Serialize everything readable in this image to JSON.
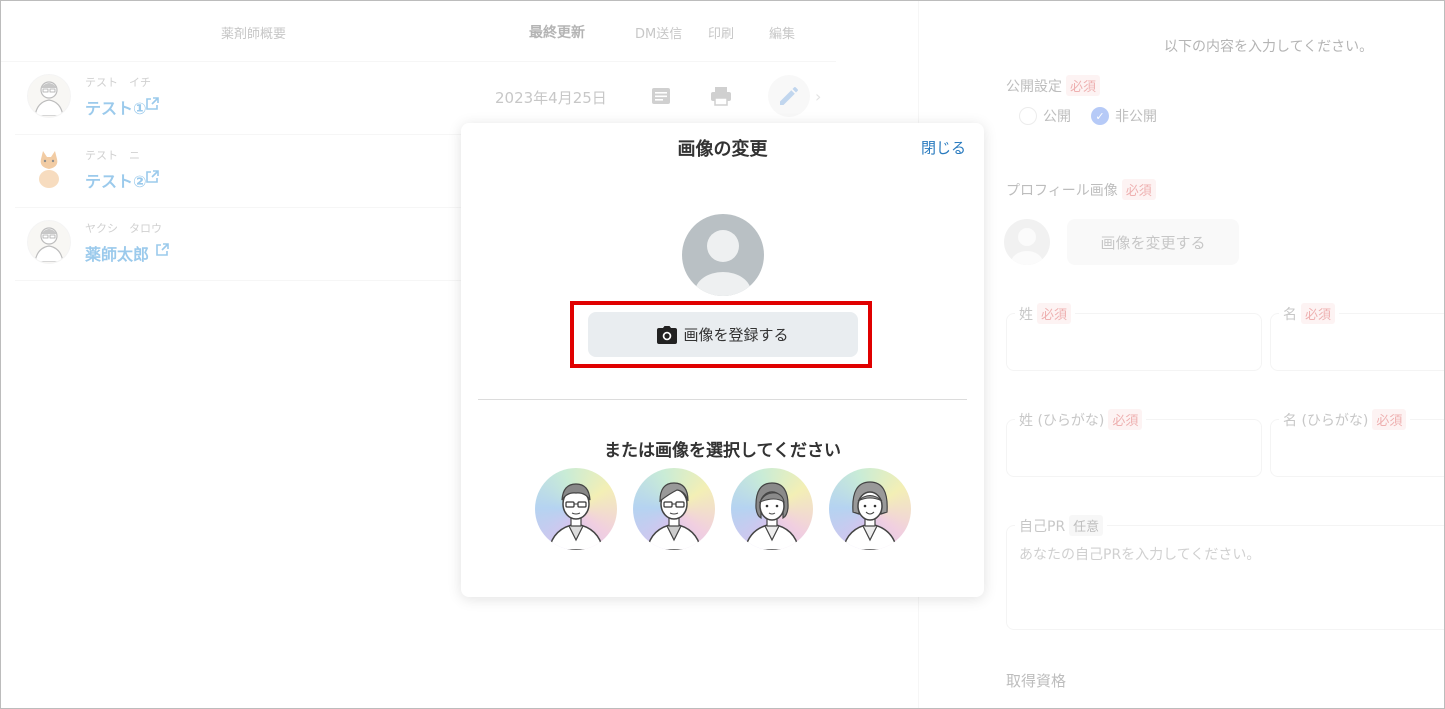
{
  "list": {
    "headers": {
      "summary": "薬剤師概要",
      "updated": "最終更新",
      "dm": "DM送信",
      "print": "印刷",
      "edit": "編集"
    },
    "rows": [
      {
        "kana": "テスト　イチ",
        "name": "テスト①",
        "date": "2023年4月25日"
      },
      {
        "kana": "テスト　ニ",
        "name": "テスト②",
        "date": ""
      },
      {
        "kana": "ヤクシ　タロウ",
        "name": "薬師太郎",
        "date": ""
      }
    ]
  },
  "form": {
    "intro": "以下の内容を入力してください。",
    "visibility": {
      "label": "公開設定",
      "required": "必須",
      "option_public": "公開",
      "option_private": "非公開"
    },
    "profile_image": {
      "label": "プロフィール画像",
      "required": "必須",
      "change_button": "画像を変更する"
    },
    "last_name": {
      "label": "姓",
      "required": "必須"
    },
    "first_name": {
      "label": "名",
      "required": "必須"
    },
    "last_name_kana": {
      "label": "姓 (ひらがな)",
      "required": "必須"
    },
    "first_name_kana": {
      "label": "名 (ひらがな)",
      "required": "必須"
    },
    "self_pr": {
      "label": "自己PR",
      "optional": "任意",
      "placeholder": "あなたの自己PRを入力してください。"
    },
    "qualifications": {
      "label": "取得資格"
    }
  },
  "modal": {
    "title": "画像の変更",
    "close": "閉じる",
    "register_button": "画像を登録する",
    "choose_text": "または画像を選択してください",
    "presets": [
      "male-pharmacist-glasses",
      "male-pharmacist-glasses-2",
      "female-pharmacist-short-hair",
      "female-pharmacist-bob"
    ]
  },
  "colors": {
    "highlight": "#e00000",
    "link": "#2a7bbf",
    "name_link": "#4a9fdc",
    "required": "#e07070"
  }
}
